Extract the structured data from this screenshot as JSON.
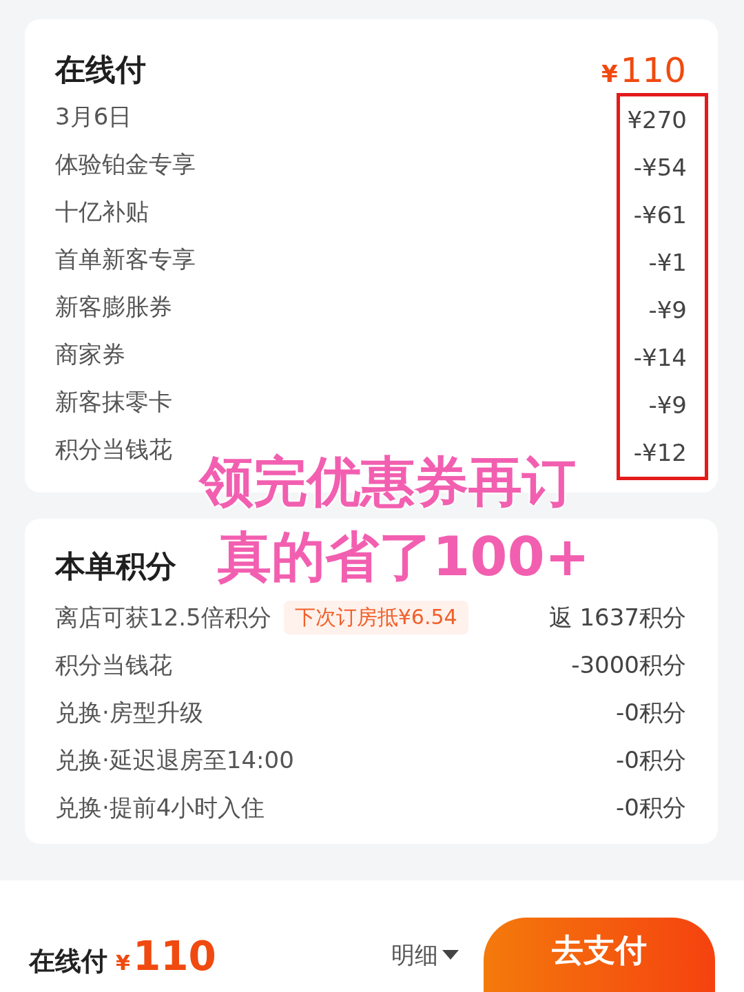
{
  "payment_card": {
    "title": "在线付",
    "currency": "¥",
    "amount": "110",
    "amounts_highlighted": true,
    "items": [
      {
        "label": "3月6日",
        "amount": "¥270"
      },
      {
        "label": "体验铂金专享",
        "amount": "-¥54"
      },
      {
        "label": "十亿补贴",
        "amount": "-¥61"
      },
      {
        "label": "首单新客专享",
        "amount": "-¥1"
      },
      {
        "label": "新客膨胀券",
        "amount": "-¥9"
      },
      {
        "label": "商家券",
        "amount": "-¥14"
      },
      {
        "label": "新客抹零卡",
        "amount": "-¥9"
      },
      {
        "label": "积分当钱花",
        "amount": "-¥12"
      }
    ]
  },
  "caption": [
    "领完优惠券再订",
    "真的省了100+"
  ],
  "points_card": {
    "title": "本单积分",
    "rows": [
      {
        "label": "离店可获12.5倍积分",
        "tag": "下次订房抵¥6.54",
        "value": "返 1637积分"
      },
      {
        "label": "积分当钱花",
        "value": "-3000积分"
      },
      {
        "label": "兑换·房型升级",
        "value": "-0积分"
      },
      {
        "label": "兑换·延迟退房至14:00",
        "value": "-0积分"
      },
      {
        "label": "兑换·提前4小时入住",
        "value": "-0积分"
      }
    ]
  },
  "bottom_bar": {
    "label": "在线付",
    "currency": "¥",
    "amount": "110",
    "details": "明细",
    "pay_button": "去支付"
  }
}
